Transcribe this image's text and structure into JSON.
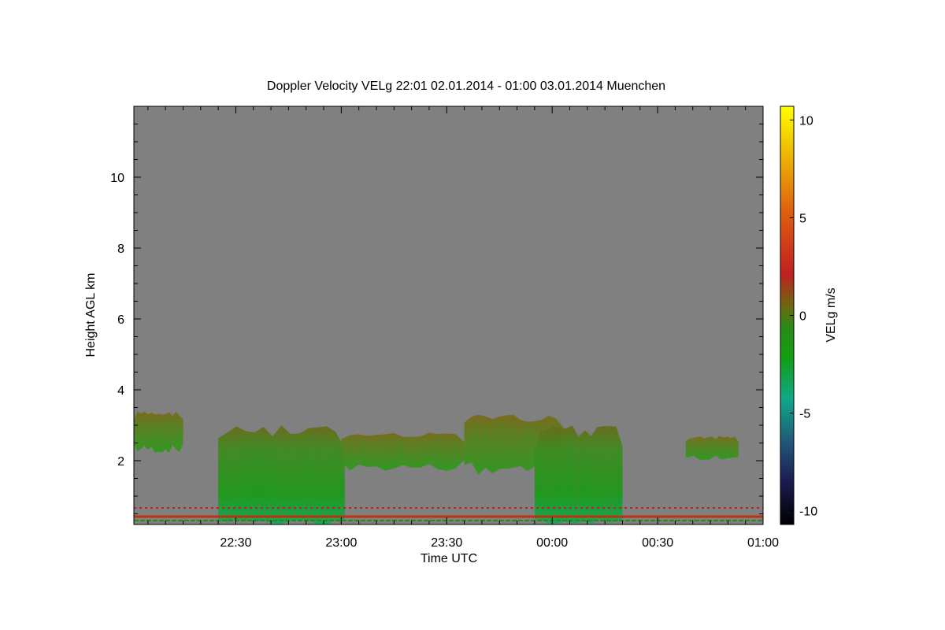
{
  "chart_data": {
    "type": "heatmap",
    "title": "Doppler Velocity VELg   22:01 02.01.2014 - 01:00 03.01.2014 Muenchen",
    "xlabel": "Time UTC",
    "ylabel": "Height AGL km",
    "colorbar_label": "VELg m/s",
    "x_range": [
      "22:01",
      "01:00"
    ],
    "x_ticks": [
      "22:30",
      "23:00",
      "23:30",
      "00:00",
      "00:30",
      "01:00"
    ],
    "y_range_km": [
      0.2,
      12.0
    ],
    "y_ticks": [
      2,
      4,
      6,
      8,
      10
    ],
    "colorbar_range": [
      -10.7,
      10.7
    ],
    "colorbar_ticks": [
      "10",
      "5",
      "0",
      "-5",
      "-10"
    ],
    "colorbar_tick_values": [
      10,
      5,
      0,
      -5,
      -10
    ],
    "colors": {
      "background_no_signal": "#808080",
      "colormap": [
        "#000000",
        "#1a1a50",
        "#1f5a7a",
        "#10a888",
        "#10a010",
        "#1f8a1f",
        "#6a6a10",
        "#c02020",
        "#e05010",
        "#f0b000",
        "#ffff00"
      ]
    },
    "cloud_regions": [
      {
        "time_start": "22:01",
        "time_end": "22:15",
        "base_km": 2.2,
        "top_km": 3.4,
        "mean_velocity": -1.0
      },
      {
        "time_start": "22:25",
        "time_end": "23:01",
        "base_km": 0.2,
        "top_km": 3.0,
        "mean_velocity": -1.5
      },
      {
        "time_start": "23:00",
        "time_end": "23:35",
        "base_km": 1.7,
        "top_km": 2.8,
        "mean_velocity": -0.5
      },
      {
        "time_start": "23:35",
        "time_end": "00:03",
        "base_km": 1.6,
        "top_km": 3.3,
        "mean_velocity": -0.4
      },
      {
        "time_start": "23:55",
        "time_end": "00:20",
        "base_km": 0.2,
        "top_km": 3.0,
        "mean_velocity": -1.8
      },
      {
        "time_start": "00:38",
        "time_end": "00:53",
        "base_km": 2.0,
        "top_km": 2.7,
        "mean_velocity": -0.3
      }
    ]
  }
}
